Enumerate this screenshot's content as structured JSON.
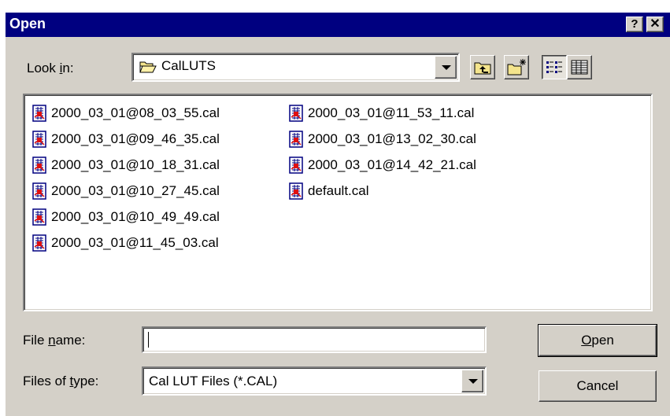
{
  "window": {
    "title": "Open",
    "help_label": "?",
    "close_label": "✕"
  },
  "look_in": {
    "label_pre": "Look ",
    "label_key": "i",
    "label_post": "n:",
    "value": "CalLUTS",
    "folder_icon": "folder-open-icon"
  },
  "toolbar": {
    "up_folder": "up-one-level-icon",
    "new_folder": "new-folder-icon",
    "list_view": "list-view-icon",
    "details_view": "details-view-icon"
  },
  "files": {
    "column1": [
      "2000_03_01@08_03_55.cal",
      "2000_03_01@09_46_35.cal",
      "2000_03_01@10_18_31.cal",
      "2000_03_01@10_27_45.cal",
      "2000_03_01@10_49_49.cal",
      "2000_03_01@11_45_03.cal"
    ],
    "column2": [
      "2000_03_01@11_53_11.cal",
      "2000_03_01@13_02_30.cal",
      "2000_03_01@14_42_21.cal",
      "default.cal"
    ]
  },
  "file_name": {
    "label_pre": "File ",
    "label_key": "n",
    "label_post": "ame:",
    "value": ""
  },
  "file_type": {
    "label_pre": "Files of ",
    "label_key": "t",
    "label_post": "ype:",
    "value": "Cal LUT Files (*.CAL)"
  },
  "buttons": {
    "open_key": "O",
    "open_rest": "pen",
    "cancel": "Cancel"
  },
  "colors": {
    "titlebar": "#000080",
    "face": "#d4d0c8"
  }
}
